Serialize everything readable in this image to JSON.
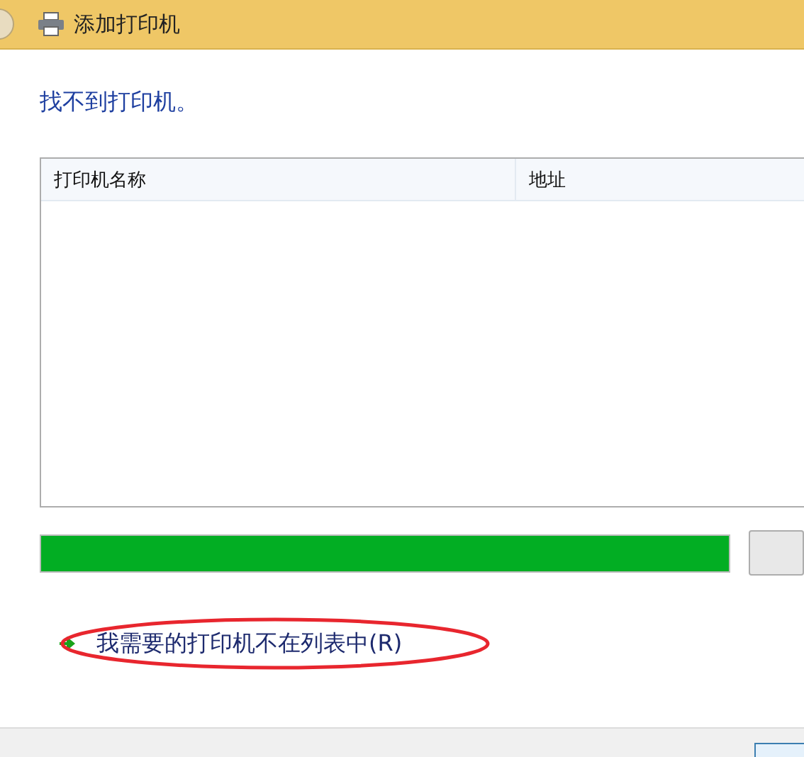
{
  "window": {
    "title": "添加打印机"
  },
  "heading": "找不到打印机。",
  "table": {
    "columns": [
      "打印机名称",
      "地址"
    ]
  },
  "progress": {
    "level": 1
  },
  "link": {
    "label": "我需要的打印机不在列表中(R)"
  }
}
